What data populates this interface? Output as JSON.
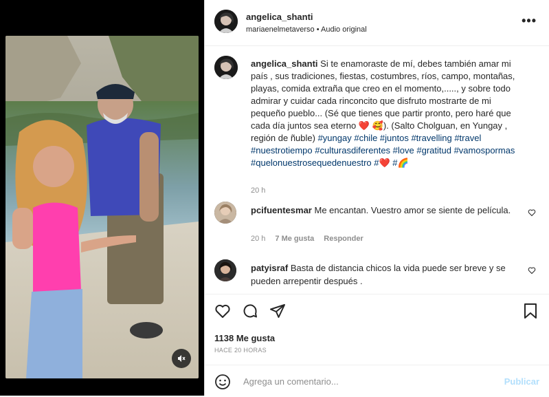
{
  "post": {
    "username": "angelica_shanti",
    "audio_source": "mariaenelmetaverso",
    "audio_label": "Audio original",
    "more_icon": "more-dots-icon"
  },
  "caption": {
    "username": "angelica_shanti",
    "text": "Si te enamoraste de mí, debes también amar mi país , sus tradiciones, fiestas, costumbres, ríos, campo, montañas, playas, comida extraña que creo en el momento,....., y sobre todo admirar y cuidar cada rinconcito que disfruto mostrarte de mi pequeño pueblo... (Sé que tienes que partir pronto, pero haré que cada día juntos sea eterno ❤️ 🥰). (Salto Cholguan, en Yungay , región de ñuble) ",
    "hashtags": "#yungay #chile #juntos #travelling #travel #nuestrotiempo #culturasdiferentes #love #gratitud #vamospormas #quelonuestrosequedenuestro #❤️ #🌈",
    "time": "20 h"
  },
  "comments": [
    {
      "username": "pcifuentesmar",
      "text": "Me encantan. Vuestro amor se siente de película.",
      "time": "20 h",
      "likes": "7 Me gusta",
      "reply": "Responder"
    },
    {
      "username": "patyisraf",
      "text": "Basta de distancia chicos la vida puede ser breve y se pueden arrepentir después ."
    }
  ],
  "stats": {
    "likes": "1138 Me gusta",
    "ago": "HACE 20 HORAS"
  },
  "composer": {
    "placeholder": "Agrega un comentario...",
    "post_label": "Publicar"
  },
  "colors": {
    "link": "#00376b",
    "muted": "#8e8e8e",
    "publish_disabled": "#b2dffc"
  }
}
